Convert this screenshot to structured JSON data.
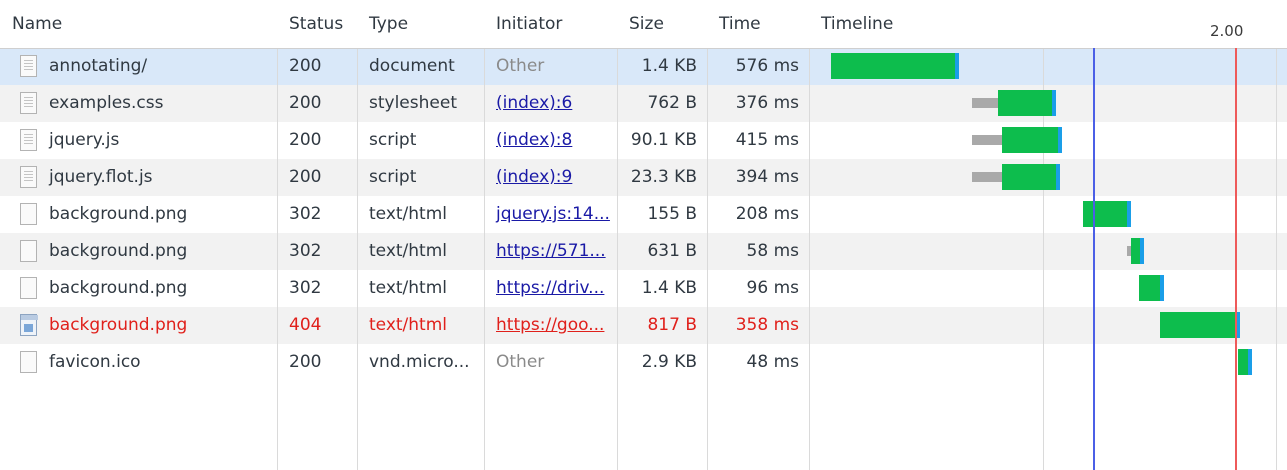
{
  "columns": {
    "name": "Name",
    "status": "Status",
    "type": "Type",
    "initiator": "Initiator",
    "size": "Size",
    "time": "Time",
    "timeline": "Timeline"
  },
  "timeline_tick": "2.00",
  "colors": {
    "selected_row": "#d9e8f9",
    "error_text": "#e0201b",
    "link": "#1a1aa6",
    "download_bar": "#0dbd4d",
    "receive_cap": "#1a9ee8",
    "waiting_bar": "#a9a9a9",
    "dom_content_loaded_line": "#4b5fe6",
    "load_line": "#ee5a5a"
  },
  "rows": [
    {
      "name": "annotating/",
      "status": "200",
      "type": "document",
      "initiator": "Other",
      "initiator_kind": "text",
      "size": "1.4 KB",
      "time": "576 ms",
      "icon": "document-icon",
      "state": "selected"
    },
    {
      "name": "examples.css",
      "status": "200",
      "type": "stylesheet",
      "initiator": "(index):6",
      "initiator_kind": "link",
      "size": "762 B",
      "time": "376 ms",
      "icon": "document-icon",
      "state": "normal"
    },
    {
      "name": "jquery.js",
      "status": "200",
      "type": "script",
      "initiator": "(index):8",
      "initiator_kind": "link",
      "size": "90.1 KB",
      "time": "415 ms",
      "icon": "document-icon",
      "state": "normal"
    },
    {
      "name": "jquery.flot.js",
      "status": "200",
      "type": "script",
      "initiator": "(index):9",
      "initiator_kind": "link",
      "size": "23.3 KB",
      "time": "394 ms",
      "icon": "document-icon",
      "state": "normal"
    },
    {
      "name": "background.png",
      "status": "302",
      "type": "text/html",
      "initiator": "jquery.js:14...",
      "initiator_kind": "link",
      "size": "155 B",
      "time": "208 ms",
      "icon": "blank-file-icon",
      "state": "normal"
    },
    {
      "name": "background.png",
      "status": "302",
      "type": "text/html",
      "initiator": "https://571...",
      "initiator_kind": "link",
      "size": "631 B",
      "time": "58 ms",
      "icon": "blank-file-icon",
      "state": "normal"
    },
    {
      "name": "background.png",
      "status": "302",
      "type": "text/html",
      "initiator": "https://driv...",
      "initiator_kind": "link",
      "size": "1.4 KB",
      "time": "96 ms",
      "icon": "blank-file-icon",
      "state": "normal"
    },
    {
      "name": "background.png",
      "status": "404",
      "type": "text/html",
      "initiator": "https://goo...",
      "initiator_kind": "link",
      "size": "817 B",
      "time": "358 ms",
      "icon": "image-file-icon",
      "state": "error"
    },
    {
      "name": "favicon.ico",
      "status": "200",
      "type": "vnd.micro...",
      "initiator": "Other",
      "initiator_kind": "text",
      "size": "2.9 KB",
      "time": "48 ms",
      "icon": "blank-file-icon",
      "state": "normal"
    }
  ]
}
